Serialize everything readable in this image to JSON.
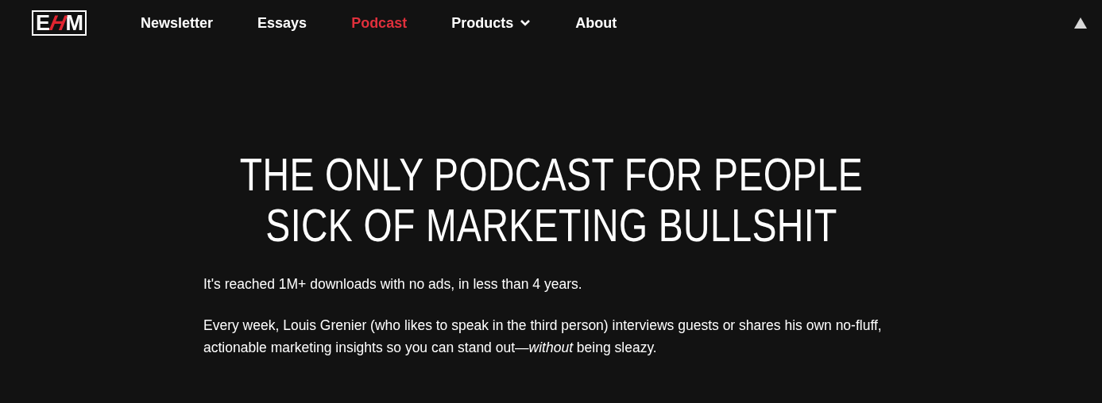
{
  "logo": {
    "letters": [
      "E",
      "H",
      "M"
    ]
  },
  "nav": [
    {
      "label": "Newsletter",
      "selected": false,
      "kind": "link"
    },
    {
      "label": "Essays",
      "selected": false,
      "kind": "link"
    },
    {
      "label": "Podcast",
      "selected": true,
      "kind": "link"
    },
    {
      "label": "Products",
      "selected": false,
      "kind": "dropdown"
    },
    {
      "label": "About",
      "selected": false,
      "kind": "link"
    }
  ],
  "hero": {
    "title": "THE ONLY PODCAST FOR PEOPLE SICK OF MARKETING BULLSHIT",
    "paragraphs": [
      "It's reached 1M+ downloads with no ads, in less than 4 years.",
      "Every week, Louis Grenier (who likes to speak in the third person) interviews guests or shares his own no-fluff, actionable marketing insights so you can stand out—*without* being sleazy."
    ]
  }
}
